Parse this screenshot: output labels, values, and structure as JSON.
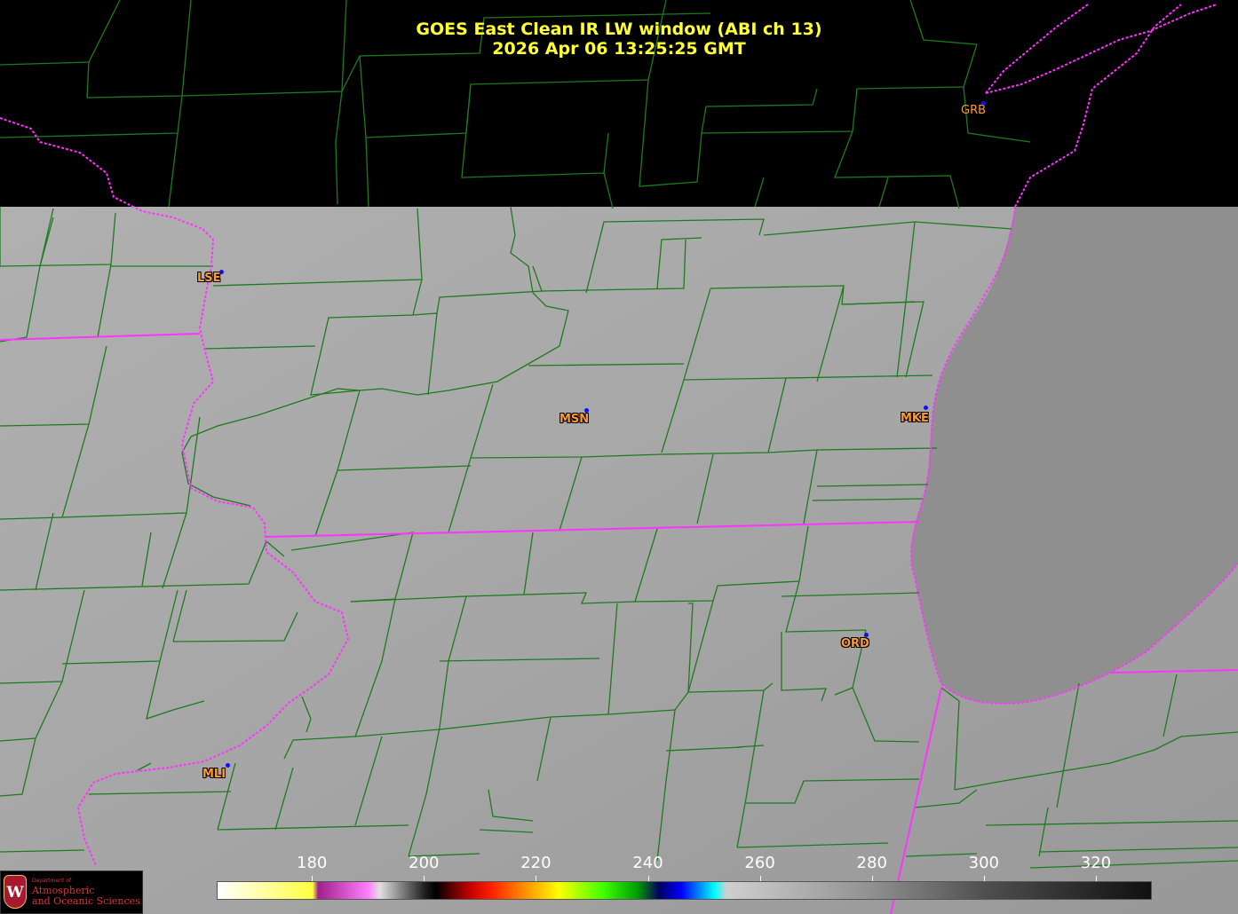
{
  "header": {
    "title_line1": "GOES East Clean IR LW window (ABI ch 13)",
    "title_line2": "2026 Apr 06  13:25:25 GMT"
  },
  "stations": [
    {
      "code": "GRB"
    },
    {
      "code": "LSE"
    },
    {
      "code": "MSN"
    },
    {
      "code": "MKE"
    },
    {
      "code": "ORD"
    },
    {
      "code": "MLI"
    }
  ],
  "colorbar": {
    "ticks": [
      "180",
      "200",
      "220",
      "240",
      "260",
      "280",
      "300",
      "320"
    ],
    "units_min": 163,
    "units_max": 330
  },
  "logo": {
    "dept_label": "Department of",
    "line1": "Atmospheric",
    "line2": "and Oceanic Sciences",
    "crest_letter": "W"
  },
  "colors": {
    "title": "#ffff33",
    "county_lines": "#1f7a1f",
    "state_borders": "#ff33ff",
    "station_label": "#ff9933",
    "station_dot": "#1010ff",
    "land": "#a8a8a8",
    "lake": "#8e8e8e",
    "no_data": "#000000"
  }
}
